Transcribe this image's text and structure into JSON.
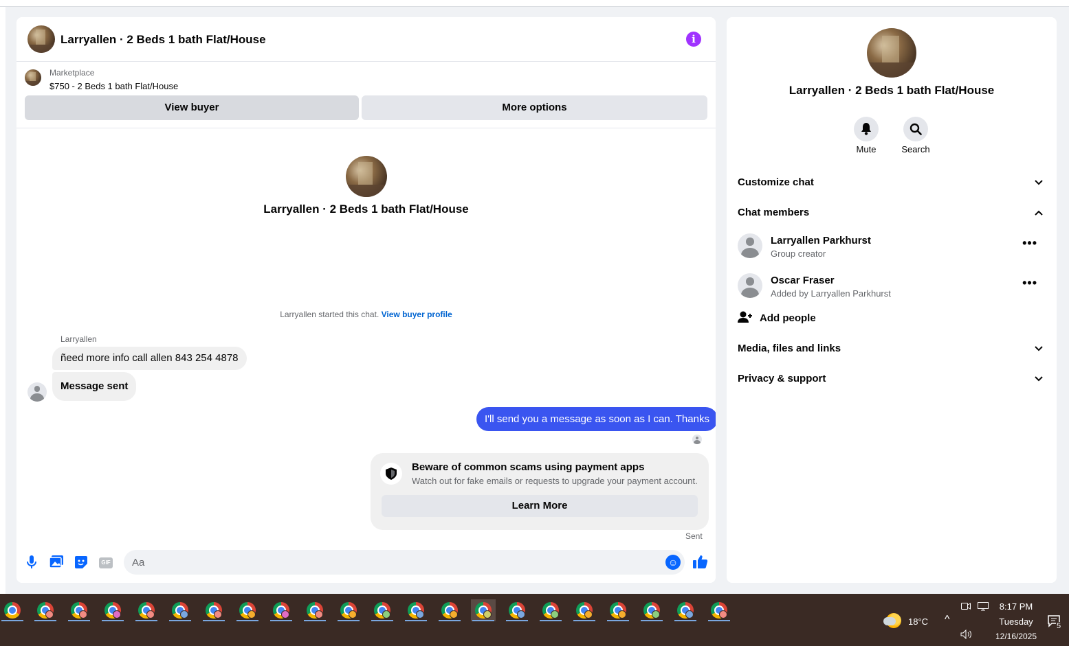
{
  "chat": {
    "title": "Larryallen · 2 Beds 1 bath Flat/House",
    "marketplace_label": "Marketplace",
    "listing": "$750 - 2 Beds 1 bath Flat/House",
    "view_buyer": "View buyer",
    "more_options": "More options",
    "center_title": "Larryallen · 2 Beds 1 bath Flat/House",
    "started_text": "Larryallen started this chat.",
    "view_buyer_profile": "View buyer profile",
    "sender_name": "Larryallen",
    "messages": [
      {
        "text": "ñeed more info call allen 843 254 4878",
        "direction": "in"
      },
      {
        "text": "Message sent",
        "direction": "in"
      },
      {
        "text": "I'll send you a message as soon as I can. Thanks",
        "direction": "out"
      }
    ],
    "scam_card": {
      "title": "Beware of common scams using payment apps",
      "description": "Watch out for fake emails or requests to upgrade your payment account.",
      "button": "Learn More"
    },
    "sent_label": "Sent",
    "composer": {
      "placeholder": "Aa",
      "icons": [
        "microphone-icon",
        "photo-icon",
        "sticker-icon",
        "gif-icon",
        "emoji-icon",
        "like-icon"
      ],
      "gif_label": "GIF"
    }
  },
  "side": {
    "title": "Larryallen · 2 Beds 1 bath Flat/House",
    "mute_label": "Mute",
    "search_label": "Search",
    "customize_chat": "Customize chat",
    "chat_members": "Chat members",
    "members": [
      {
        "name": "Larryallen Parkhurst",
        "role": "Group creator"
      },
      {
        "name": "Oscar Fraser",
        "role": "Added by Larryallen Parkhurst"
      }
    ],
    "add_people": "Add people",
    "media_files_links": "Media, files and links",
    "privacy_support": "Privacy & support"
  },
  "taskbar": {
    "temperature": "18°C",
    "time": "8:17 PM",
    "day": "Tuesday",
    "date": "12/16/2025",
    "notification_count": "5"
  },
  "colors": {
    "accent": "#0866ff",
    "outgoing_bubble": "#3a55f0",
    "info_icon": "#a033ff",
    "link": "#0064d1"
  }
}
